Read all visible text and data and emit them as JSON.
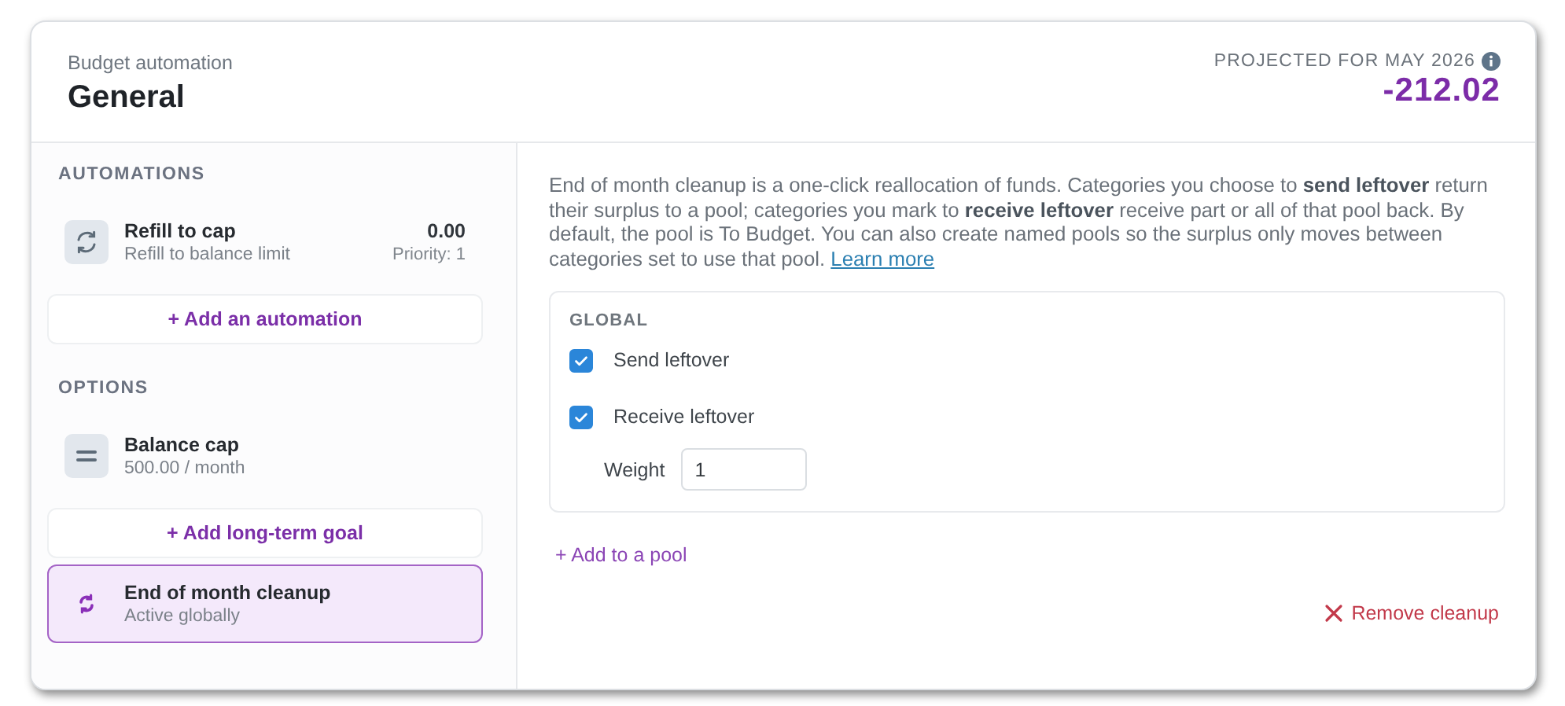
{
  "header": {
    "eyebrow": "Budget automation",
    "title": "General",
    "projection_label": "PROJECTED FOR MAY 2026",
    "projection_value": "-212.02"
  },
  "sidebar": {
    "sections": [
      {
        "heading": "AUTOMATIONS",
        "items": [
          {
            "kind": "automation",
            "title": "Refill to cap",
            "subtitle": "Refill to balance limit",
            "amount": "0.00",
            "priority": "Priority: 1",
            "selected": false
          },
          {
            "kind": "add",
            "title": "+ Add an automation"
          }
        ]
      },
      {
        "heading": "OPTIONS",
        "items": [
          {
            "kind": "cap",
            "title": "Balance cap",
            "subtitle": "500.00 / month",
            "selected": false
          },
          {
            "kind": "add",
            "title": "+ Add long-term goal"
          },
          {
            "kind": "cleanup",
            "title": "End of month cleanup",
            "subtitle": "Active globally",
            "selected": true
          }
        ]
      }
    ]
  },
  "detail": {
    "description": "End of month cleanup is a one-click reallocation of funds. Categories you choose to **send leftover** return their surplus to a pool; categories you mark to **receive leftover** receive part or all of that pool back. By default, the pool is To Budget. You can also create named pools so the surplus only moves between categories set to use that pool.",
    "link": "Learn more",
    "pool": {
      "heading": "GLOBAL",
      "options": [
        {
          "label": "Send leftover",
          "checked": true
        },
        {
          "label": "Receive leftover",
          "checked": true
        }
      ],
      "weight_label": "Weight",
      "weight_value": "1"
    },
    "add_pool": "+ Add to a pool",
    "remove": "Remove cleanup"
  }
}
